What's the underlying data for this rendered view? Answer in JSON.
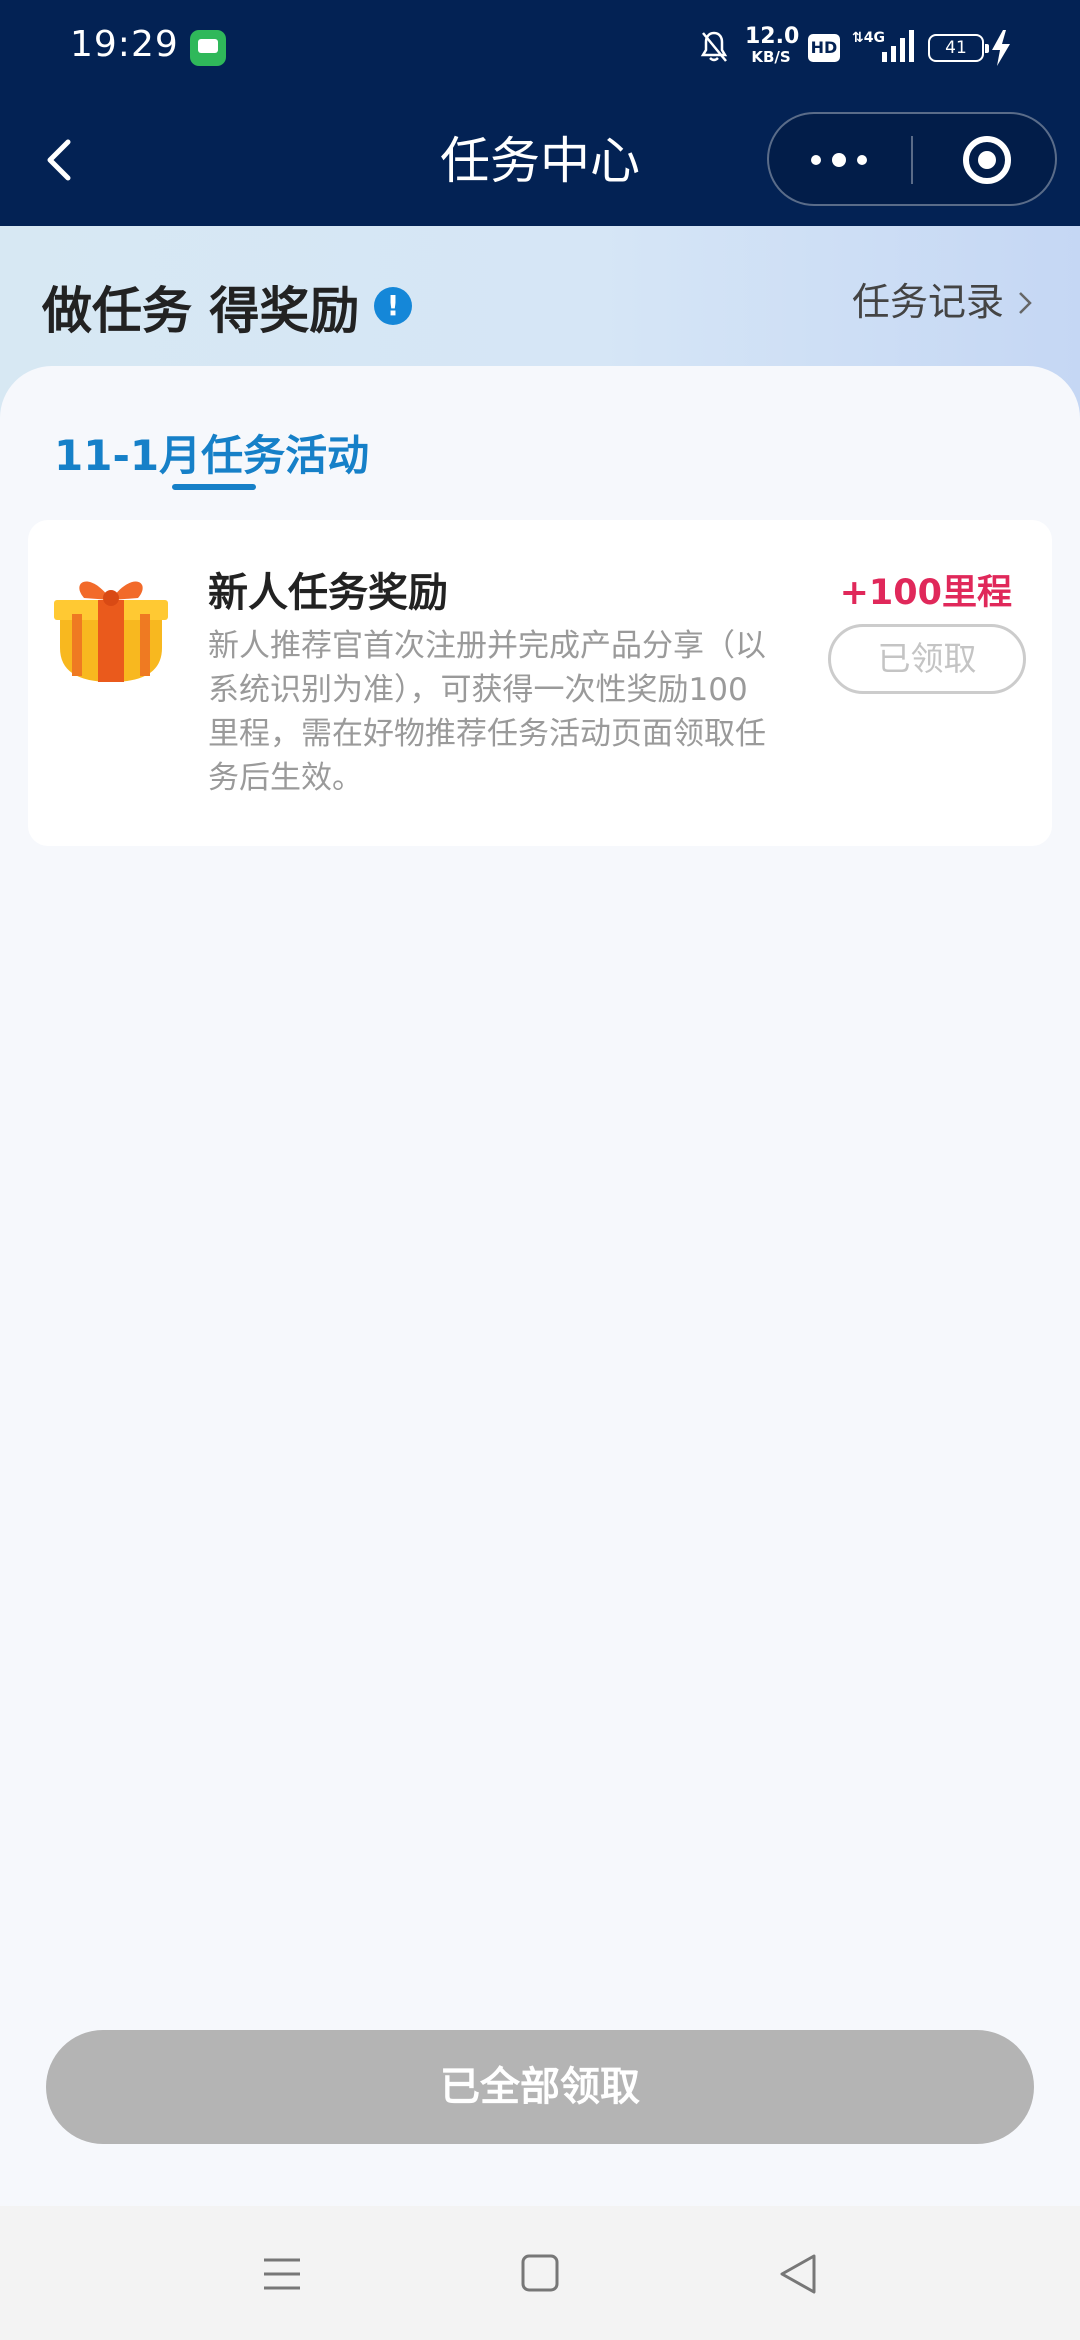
{
  "status_bar": {
    "time": "19:29",
    "net_speed_value": "12.0",
    "net_speed_unit": "KB/S",
    "hd_label": "HD",
    "battery_level": "41"
  },
  "nav": {
    "title": "任务中心"
  },
  "header": {
    "headline": "做任务 得奖励",
    "record_link": "任务记录"
  },
  "tab": {
    "label": "11-1月任务活动"
  },
  "task": {
    "title": "新人任务奖励",
    "description": "新人推荐官首次注册并完成产品分享（以系统识别为准），可获得一次性奖励100里程，需在好物推荐任务活动页面领取任务后生效。",
    "reward": "+100里程",
    "button_label": "已领取"
  },
  "footer": {
    "claim_all_label": "已全部领取"
  },
  "colors": {
    "nav_bg": "#032254",
    "accent_blue": "#1680c8",
    "reward_red": "#e0285a",
    "disabled_gray": "#b4b4b4"
  },
  "icons": [
    "chat-app-icon",
    "bell-off-icon",
    "signal-icon",
    "battery-icon",
    "charging-icon",
    "back-arrow-icon",
    "more-dots-icon",
    "close-miniprogram-icon",
    "info-icon",
    "chevron-right-icon",
    "gift-icon",
    "menu-icon",
    "home-icon",
    "back-triangle-icon"
  ]
}
